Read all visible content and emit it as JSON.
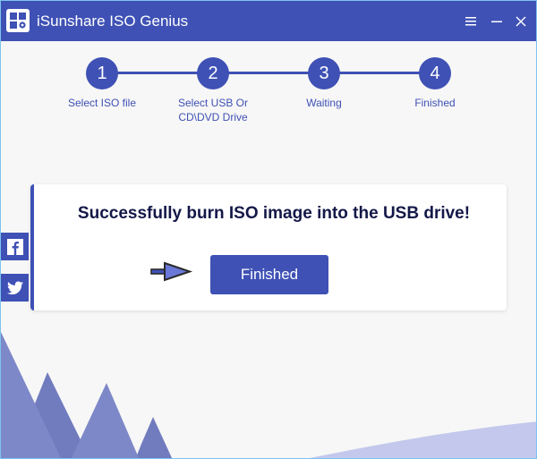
{
  "window": {
    "title": "iSunshare ISO Genius",
    "controls": [
      "menu",
      "minimize",
      "close"
    ]
  },
  "steps": [
    {
      "number": "1",
      "label": "Select ISO file"
    },
    {
      "number": "2",
      "label": "Select USB Or CD\\DVD Drive"
    },
    {
      "number": "3",
      "label": "Waiting"
    },
    {
      "number": "4",
      "label": "Finished"
    }
  ],
  "social": {
    "facebook": "facebook-icon",
    "twitter": "twitter-icon"
  },
  "result": {
    "message": "Successfully burn ISO image into the USB drive!",
    "button_label": "Finished"
  },
  "colors": {
    "brand": "#3f51b5",
    "title_text": "#141848",
    "background": "#f7f7f7"
  }
}
